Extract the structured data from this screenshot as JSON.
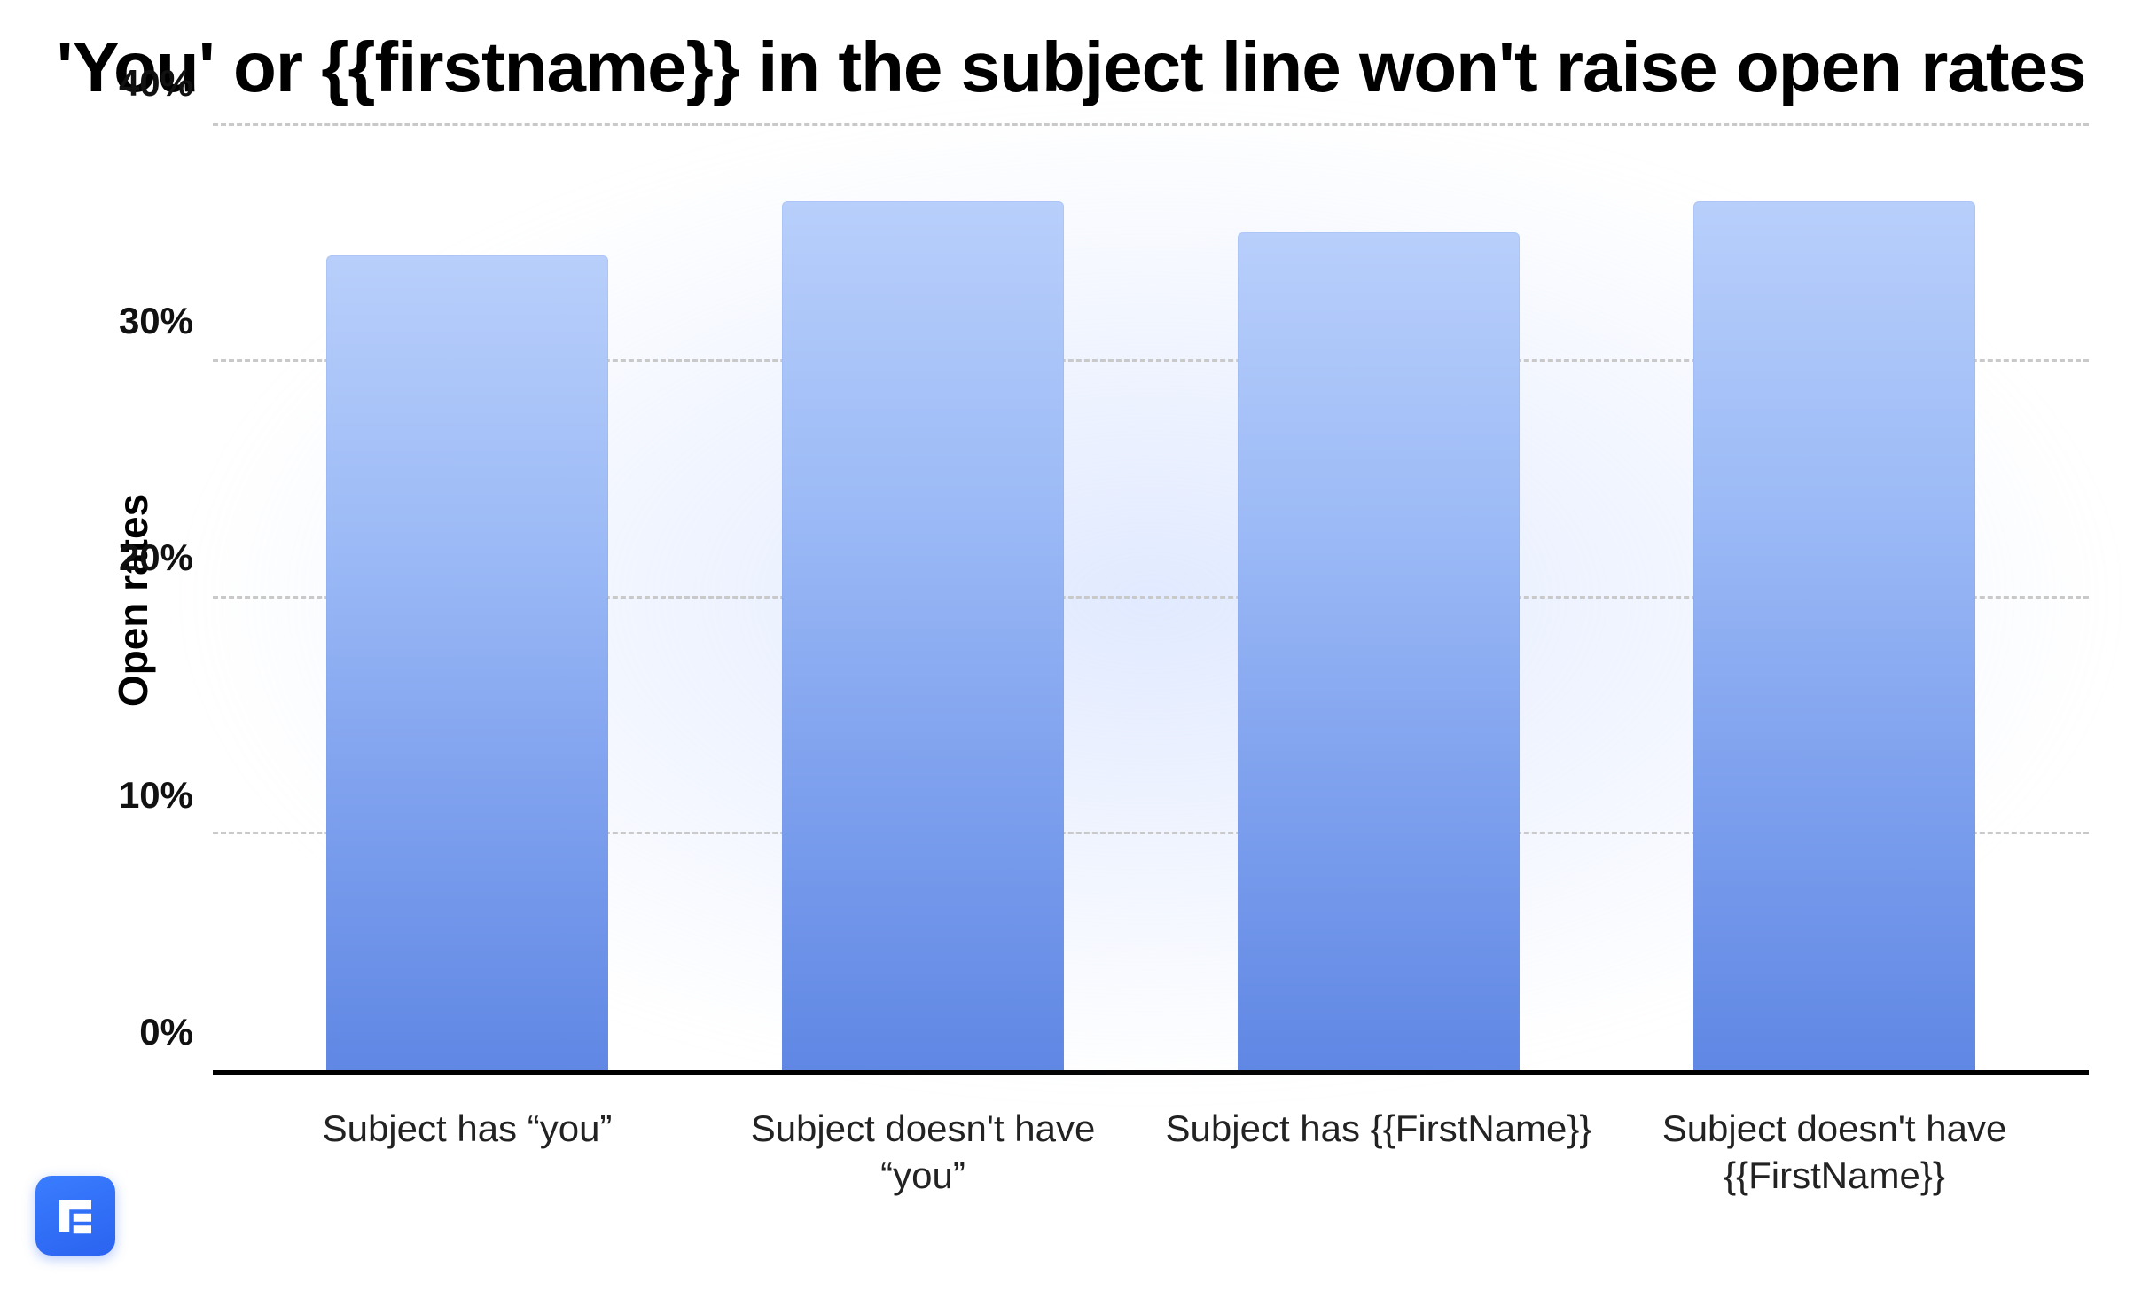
{
  "chart_data": {
    "type": "bar",
    "title": "'You' or {{firstname}} in the subject line won't raise open rates",
    "ylabel": "Open rates",
    "xlabel": "",
    "ylim": [
      0,
      40
    ],
    "yticks": [
      "0%",
      "10%",
      "20%",
      "30%",
      "40%"
    ],
    "categories": [
      "Subject has “you”",
      "Subject doesn't have “you”",
      "Subject has {{FirstName}}",
      "Subject doesn't have {{FirstName}}"
    ],
    "values": [
      34.5,
      36.8,
      35.5,
      36.8
    ],
    "bar_color_top": "#b8cffb",
    "bar_color_bottom": "#5f87e4"
  },
  "logo_name": "lemlist"
}
